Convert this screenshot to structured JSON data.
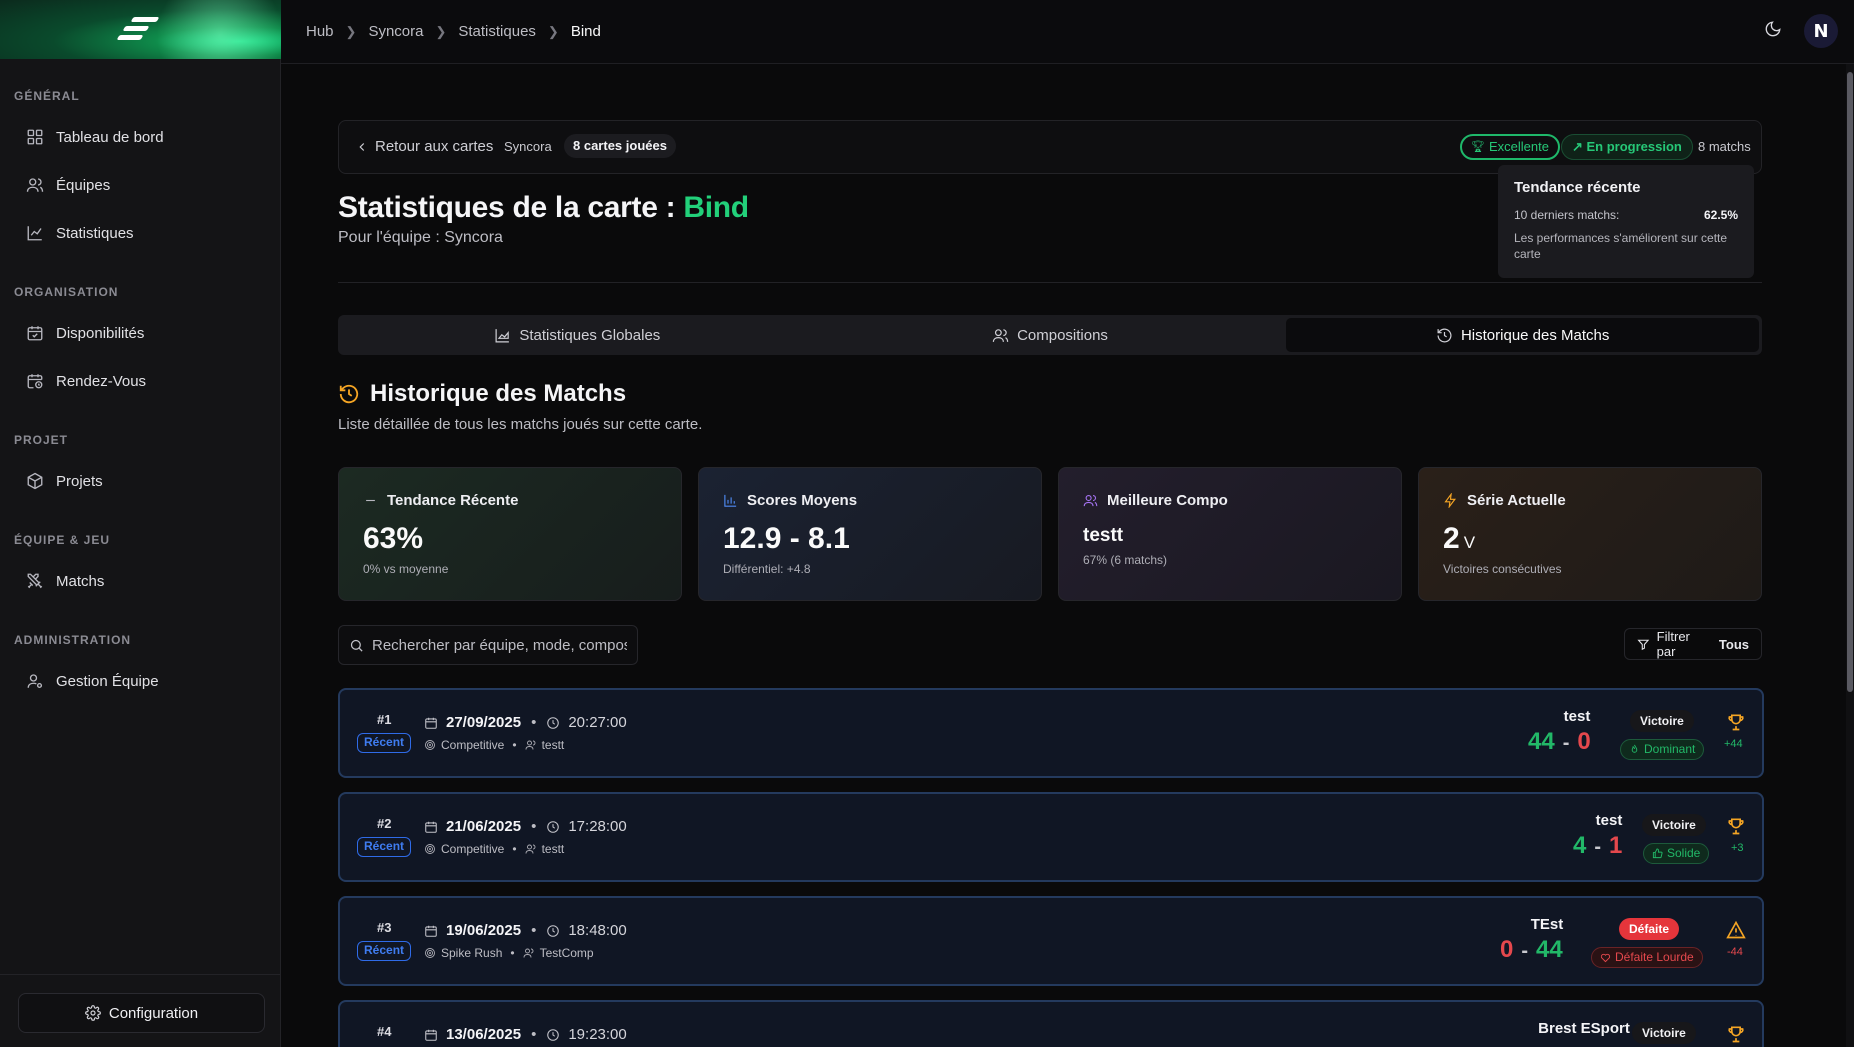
{
  "sidebar": {
    "sections": [
      {
        "heading": "GÉNÉRAL",
        "items": [
          "Tableau de bord",
          "Équipes",
          "Statistiques"
        ]
      },
      {
        "heading": "ORGANISATION",
        "items": [
          "Disponibilités",
          "Rendez-Vous"
        ]
      },
      {
        "heading": "PROJET",
        "items": [
          "Projets"
        ]
      },
      {
        "heading": "ÉQUIPE & JEU",
        "items": [
          "Matchs"
        ]
      },
      {
        "heading": "ADMINISTRATION",
        "items": [
          "Gestion Équipe"
        ]
      }
    ],
    "config_label": "Configuration"
  },
  "breadcrumb": [
    "Hub",
    "Syncora",
    "Statistiques",
    "Bind"
  ],
  "header": {
    "back_label": "Retour aux cartes",
    "team": "Syncora",
    "cards_played": "8 cartes jouées",
    "badge_excellent": "Excellente",
    "badge_progress": "En progression",
    "match_count": "8 matchs"
  },
  "tooltip": {
    "title": "Tendance récente",
    "row_label": "10 derniers matchs:",
    "row_value": "62.5%",
    "note": "Les performances s'améliorent sur cette carte"
  },
  "page": {
    "title_prefix": "Statistiques de la carte : ",
    "map_name": "Bind",
    "subtitle": "Pour l'équipe : Syncora"
  },
  "tabs": [
    "Statistiques Globales",
    "Compositions",
    "Historique des Matchs"
  ],
  "section": {
    "title": "Historique des Matchs",
    "subtitle": "Liste détaillée de tous les matchs joués sur cette carte."
  },
  "stats": {
    "trend": {
      "label": "Tendance Récente",
      "value": "63%",
      "note": "0% vs moyenne"
    },
    "scores": {
      "label": "Scores Moyens",
      "value": "12.9 - 8.1",
      "note": "Différentiel: +4.8"
    },
    "compo": {
      "label": "Meilleure Compo",
      "value": "testt",
      "note": "67% (6 matchs)"
    },
    "streak": {
      "label": "Série Actuelle",
      "value": "2",
      "unit": "V",
      "note": "Victoires consécutives"
    }
  },
  "search": {
    "placeholder": "Rechercher par équipe, mode, compos"
  },
  "filter": {
    "label": "Filtrer par",
    "value": "Tous"
  },
  "matches": [
    {
      "num": "#1",
      "tag": "Récent",
      "date": "27/09/2025",
      "time": "20:27:00",
      "mode": "Competitive",
      "compo": "testt",
      "opponent": "test",
      "score_us": "44",
      "score_them": "0",
      "result": "Victoire",
      "perf": "Dominant",
      "diff": "+44"
    },
    {
      "num": "#2",
      "tag": "Récent",
      "date": "21/06/2025",
      "time": "17:28:00",
      "mode": "Competitive",
      "compo": "testt",
      "opponent": "test",
      "score_us": "4",
      "score_them": "1",
      "result": "Victoire",
      "perf": "Solide",
      "diff": "+3"
    },
    {
      "num": "#3",
      "tag": "Récent",
      "date": "19/06/2025",
      "time": "18:48:00",
      "mode": "Spike Rush",
      "compo": "TestComp",
      "opponent": "TEst",
      "score_us": "0",
      "score_them": "44",
      "result": "Défaite",
      "perf": "Défaite Lourde",
      "diff": "-44"
    },
    {
      "num": "#4",
      "date": "13/06/2025",
      "time": "19:23:00",
      "opponent": "Brest ESport",
      "result": "Victoire"
    }
  ],
  "colors": {
    "accent": "#22d07a",
    "win": "#22b868",
    "loss": "#e5484d",
    "recent": "#2f6be8",
    "trophy": "#f5a524"
  }
}
